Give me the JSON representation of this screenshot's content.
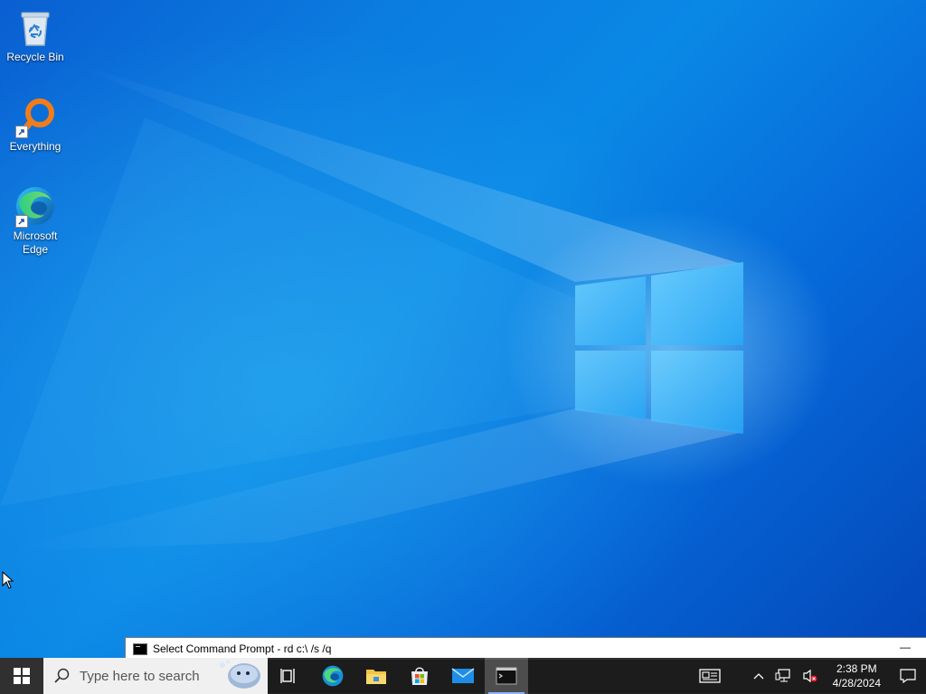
{
  "desktop": {
    "icons": [
      {
        "label": "Recycle Bin",
        "icon": "recycle-bin-icon"
      },
      {
        "label": "Everything",
        "icon": "everything-search-icon"
      },
      {
        "label": "Microsoft Edge",
        "icon": "edge-icon"
      }
    ]
  },
  "cmd_window": {
    "title": "Select Command Prompt - rd  c:\\ /s /q",
    "minimize": "—"
  },
  "taskbar": {
    "search_placeholder": "Type here to search",
    "pinned": [
      "task-view",
      "edge",
      "file-explorer",
      "microsoft-store",
      "mail",
      "command-prompt"
    ],
    "active": "command-prompt"
  },
  "tray": {
    "time": "2:38 PM",
    "date": "4/28/2024"
  },
  "colors": {
    "wallpaper_base": "#0a78e0",
    "taskbar": "#1e1e1e"
  }
}
